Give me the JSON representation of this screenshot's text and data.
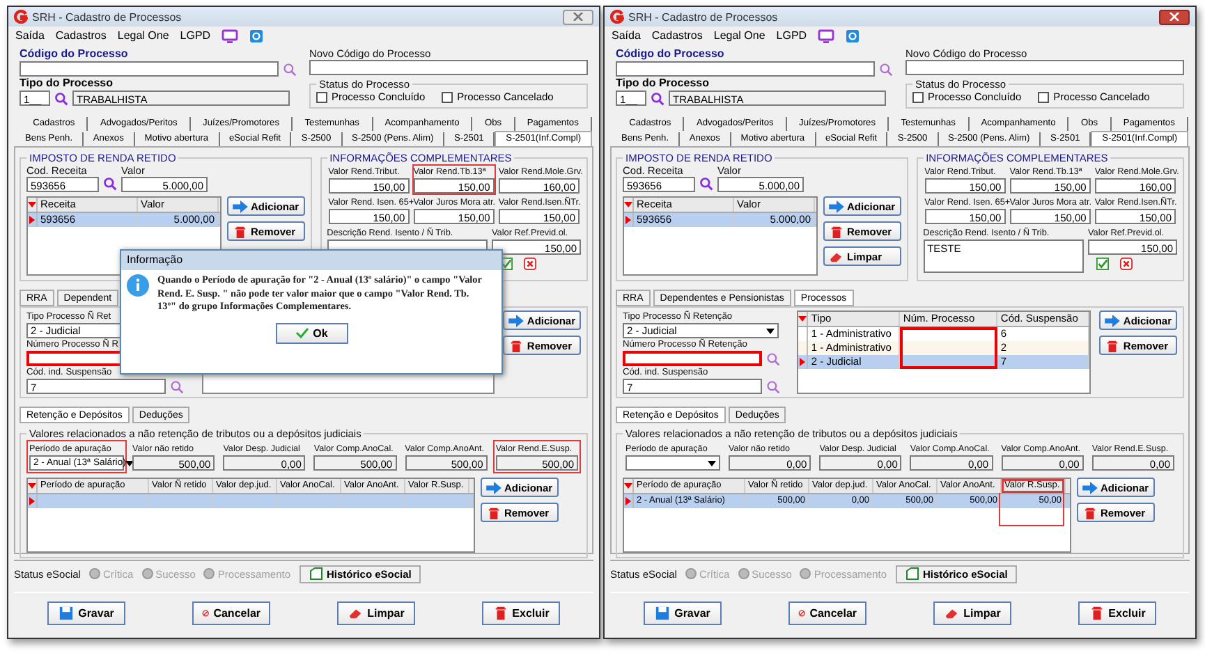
{
  "windows": [
    {
      "title": "SRH - Cadastro de Processos",
      "active": false,
      "menu": [
        "Saída",
        "Cadastros",
        "Legal One",
        "LGPD"
      ],
      "codigo": {
        "label": "Código do Processo"
      },
      "novo": {
        "label": "Novo Código do Processo"
      },
      "tipo": {
        "label": "Tipo do Processo",
        "code": "1__",
        "name": "TRABALHISTA"
      },
      "status_group": {
        "title": "Status do Processo",
        "options": [
          {
            "label": "Processo Concluído",
            "checked": false
          },
          {
            "label": "Processo Cancelado",
            "checked": false
          }
        ]
      },
      "tabs": [
        [
          {
            "label": "Cadastros",
            "selected": false
          },
          {
            "label": "Advogados/Peritos",
            "selected": false
          },
          {
            "label": "Juízes/Promotores",
            "selected": false
          },
          {
            "label": "Testemunhas",
            "selected": false
          },
          {
            "label": "Acompanhamento",
            "selected": false
          },
          {
            "label": "Obs",
            "selected": false
          },
          {
            "label": "Pagamentos",
            "selected": false
          }
        ],
        [
          {
            "label": "Bens Penh.",
            "selected": false
          },
          {
            "label": "Anexos",
            "selected": false
          },
          {
            "label": "Motivo abertura",
            "selected": false
          },
          {
            "label": "eSocial Refit",
            "selected": false
          },
          {
            "label": "S-2500",
            "selected": false
          },
          {
            "label": "S-2500 (Pens. Alim)",
            "selected": false
          },
          {
            "label": "S-2501",
            "selected": false
          },
          {
            "label": "S-2501(Inf.Compl)",
            "selected": true
          }
        ]
      ],
      "imposto": {
        "title": "IMPOSTO DE RENDA RETIDO",
        "cod_label": "Cod. Receita",
        "cod_value": "593656",
        "valor_label": "Valor",
        "valor_value": "5.000,00",
        "columns": [
          "Receita",
          "Valor"
        ],
        "rows": [
          {
            "cells": [
              "593656",
              "5.000,00"
            ],
            "selected": true
          }
        ],
        "buttons": [
          {
            "kind": "add",
            "label": "Adicionar"
          },
          {
            "kind": "remove",
            "label": "Remover"
          }
        ]
      },
      "info": {
        "title": "INFORMAÇÕES COMPLEMENTARES",
        "fields": [
          {
            "label": "Valor Rend.Tribut.",
            "value": "150,00",
            "highlighted": false
          },
          {
            "label": "Valor Rend.Tb.13ª",
            "value": "150,00",
            "highlighted": true
          },
          {
            "label": "Valor Rend.Mole.Grv.",
            "value": "160,00",
            "highlighted": false
          },
          {
            "label": "Valor Rend. Isen. 65+",
            "value": "150,00",
            "highlighted": false
          },
          {
            "label": "Valor Juros Mora atr.",
            "value": "150,00",
            "highlighted": false
          },
          {
            "label": "Valor Rend.Isen.ÑTr.",
            "value": "150,00",
            "highlighted": false
          }
        ],
        "descricao": {
          "label": "Descrição Rend. Isento / Ñ Trib."
        },
        "previd": {
          "label": "Valor Ref.Previd.ol.",
          "value": "150,00"
        }
      },
      "subtabs": [
        {
          "label": "RRA",
          "selected": false
        },
        {
          "label": "Dependent",
          "selected": false
        }
      ],
      "processos": {
        "tipo": {
          "label": "Tipo Processo Ñ Ret",
          "value": "2 - Judicial"
        },
        "numero": {
          "label": "Número Processo Ñ R",
          "highlighted": true
        },
        "cod": {
          "label": "Cód. ind. Suspensão",
          "value": "7"
        },
        "buttons": [
          {
            "kind": "add",
            "label": "Adicionar"
          },
          {
            "kind": "remove",
            "label": "Remover"
          }
        ]
      },
      "inner_tabs": [
        {
          "label": "Retenção e Depósitos",
          "selected": true
        },
        {
          "label": "Deduções",
          "selected": false
        }
      ],
      "valores": {
        "title": "Valores relacionados a não retenção de tributos ou a depósitos judiciais",
        "periodo": {
          "label": "Período de apuração",
          "value": "2 - Anual (13ª Salário)",
          "highlighted": true
        },
        "fields": [
          {
            "label": "Valor não retido",
            "value": "500,00",
            "highlighted": false
          },
          {
            "label": "Valor Desp. Judicial",
            "value": "0,00",
            "highlighted": false
          },
          {
            "label": "Valor Comp.AnoCal.",
            "value": "500,00",
            "highlighted": false
          },
          {
            "label": "Valor Comp.AnoAnt.",
            "value": "500,00",
            "highlighted": false
          },
          {
            "label": "Valor Rend.E.Susp.",
            "value": "500,00",
            "highlighted": true
          }
        ],
        "columns": [
          {
            "label": "Período de apuração",
            "highlighted": false
          },
          {
            "label": "Valor Ñ retido",
            "highlighted": false
          },
          {
            "label": "Valor dep.jud.",
            "highlighted": false
          },
          {
            "label": "Valor AnoCal.",
            "highlighted": false
          },
          {
            "label": "Valor AnoAnt.",
            "highlighted": false
          },
          {
            "label": "Valor R.Susp.",
            "highlighted": false
          }
        ],
        "rows": [
          {
            "selected": true
          }
        ],
        "buttons": [
          {
            "kind": "add",
            "label": "Adicionar"
          },
          {
            "kind": "remove",
            "label": "Remover"
          }
        ]
      },
      "status": {
        "label": "Status eSocial",
        "radios": [
          {
            "label": "Crítica",
            "disabled": true
          },
          {
            "label": "Sucesso",
            "disabled": true
          },
          {
            "label": "Processamento",
            "disabled": true
          }
        ],
        "history": "Histórico eSocial"
      },
      "footer": [
        {
          "kind": "save",
          "label": "Gravar"
        },
        {
          "kind": "cancel",
          "label": "Cancelar"
        },
        {
          "kind": "clear",
          "label": "Limpar"
        },
        {
          "kind": "delete",
          "label": "Excluir"
        }
      ],
      "dialog": {
        "title": "Informação",
        "message": "Quando o Período de apuração for \"2 - Anual (13º salário)\" o campo \"Valor Rend. E. Susp. \" não pode ter valor maior que o campo \"Valor Rend. Tb. 13º\" do grupo Informações Complementares.",
        "button": "Ok"
      }
    },
    {
      "title": "SRH - Cadastro de Processos",
      "active": true,
      "menu": [
        "Saída",
        "Cadastros",
        "Legal One",
        "LGPD"
      ],
      "codigo": {
        "label": "Código do Processo"
      },
      "novo": {
        "label": "Novo Código do Processo"
      },
      "tipo": {
        "label": "Tipo do Processo",
        "code": "1__",
        "name": "TRABALHISTA"
      },
      "status_group": {
        "title": "Status do Processo",
        "options": [
          {
            "label": "Processo Concluído",
            "checked": false
          },
          {
            "label": "Processo Cancelado",
            "checked": false
          }
        ]
      },
      "tabs": [
        [
          {
            "label": "Cadastros",
            "selected": false
          },
          {
            "label": "Advogados/Peritos",
            "selected": false
          },
          {
            "label": "Juízes/Promotores",
            "selected": false
          },
          {
            "label": "Testemunhas",
            "selected": false
          },
          {
            "label": "Acompanhamento",
            "selected": false
          },
          {
            "label": "Obs",
            "selected": false
          },
          {
            "label": "Pagamentos",
            "selected": false
          }
        ],
        [
          {
            "label": "Bens Penh.",
            "selected": false
          },
          {
            "label": "Anexos",
            "selected": false
          },
          {
            "label": "Motivo abertura",
            "selected": false
          },
          {
            "label": "eSocial Refit",
            "selected": false
          },
          {
            "label": "S-2500",
            "selected": false
          },
          {
            "label": "S-2500 (Pens. Alim)",
            "selected": false
          },
          {
            "label": "S-2501",
            "selected": false
          },
          {
            "label": "S-2501(Inf.Compl)",
            "selected": true
          }
        ]
      ],
      "imposto": {
        "title": "IMPOSTO DE RENDA RETIDO",
        "cod_label": "Cod. Receita",
        "cod_value": "593656",
        "valor_label": "Valor",
        "valor_value": "5.000,00",
        "columns": [
          "Receita",
          "Valor"
        ],
        "rows": [
          {
            "cells": [
              "593656",
              "5.000,00"
            ],
            "selected": true
          }
        ],
        "buttons": [
          {
            "kind": "add",
            "label": "Adicionar"
          },
          {
            "kind": "remove",
            "label": "Remover"
          },
          {
            "kind": "clear",
            "label": "Limpar"
          }
        ]
      },
      "info": {
        "title": "INFORMAÇÕES COMPLEMENTARES",
        "fields": [
          {
            "label": "Valor Rend.Tribut.",
            "value": "150,00",
            "highlighted": false
          },
          {
            "label": "Valor Rend.Tb.13ª",
            "value": "150,00",
            "highlighted": false
          },
          {
            "label": "Valor Rend.Mole.Grv.",
            "value": "160,00",
            "highlighted": false
          },
          {
            "label": "Valor Rend. Isen. 65+",
            "value": "150,00",
            "highlighted": false
          },
          {
            "label": "Valor Juros Mora atr.",
            "value": "150,00",
            "highlighted": false
          },
          {
            "label": "Valor Rend.Isen.ÑTr.",
            "value": "150,00",
            "highlighted": false
          }
        ],
        "descricao": {
          "label": "Descrição Rend. Isento / Ñ Trib.",
          "value": "TESTE"
        },
        "previd": {
          "label": "Valor Ref.Previd.ol.",
          "value": "150,00"
        }
      },
      "subtabs": [
        {
          "label": "RRA",
          "selected": false
        },
        {
          "label": "Dependentes e Pensionistas",
          "selected": false
        },
        {
          "label": "Processos",
          "selected": true
        }
      ],
      "processos": {
        "tipo": {
          "label": "Tipo Processo Ñ Retenção",
          "value": "2 - Judicial"
        },
        "numero": {
          "label": "Número Processo Ñ Retenção",
          "highlighted": true
        },
        "cod": {
          "label": "Cód. ind. Suspensão",
          "value": "7"
        },
        "columns": [
          "Tipo",
          "Núm. Processo",
          "Cód. Suspensão"
        ],
        "num_highlighted": true,
        "rows": [
          {
            "tipo": "1 - Administrativo",
            "cod": "6",
            "selected": false
          },
          {
            "tipo": "1 - Administrativo",
            "cod": "2",
            "selected": false
          },
          {
            "tipo": "2 - Judicial",
            "cod": "7",
            "selected": true
          }
        ],
        "buttons": [
          {
            "kind": "add",
            "label": "Adicionar"
          },
          {
            "kind": "remove",
            "label": "Remover"
          }
        ]
      },
      "inner_tabs": [
        {
          "label": "Retenção e Depósitos",
          "selected": true
        },
        {
          "label": "Deduções",
          "selected": false
        }
      ],
      "valores": {
        "title": "Valores relacionados a não retenção de tributos ou a depósitos judiciais",
        "periodo": {
          "label": "Período de apuração",
          "highlighted": false
        },
        "fields": [
          {
            "label": "Valor não retido",
            "value": "0,00",
            "highlighted": false
          },
          {
            "label": "Valor Desp. Judicial",
            "value": "0,00",
            "highlighted": false
          },
          {
            "label": "Valor Comp.AnoCal.",
            "value": "0,00",
            "highlighted": false
          },
          {
            "label": "Valor Comp.AnoAnt.",
            "value": "0,00",
            "highlighted": false
          },
          {
            "label": "Valor Rend.E.Susp.",
            "value": "0,00",
            "highlighted": false
          }
        ],
        "columns": [
          {
            "label": "Período de apuração",
            "highlighted": false
          },
          {
            "label": "Valor Ñ retido",
            "highlighted": false
          },
          {
            "label": "Valor dep.jud.",
            "highlighted": false
          },
          {
            "label": "Valor AnoCal.",
            "highlighted": false
          },
          {
            "label": "Valor AnoAnt.",
            "highlighted": false
          },
          {
            "label": "Valor R.Susp.",
            "highlighted": true
          }
        ],
        "rows": [
          {
            "cells": [
              "2 - Anual (13ª Salário)",
              "500,00",
              "0,00",
              "500,00",
              "500,00",
              "50,00"
            ],
            "selected": true
          }
        ],
        "buttons": [
          {
            "kind": "add",
            "label": "Adicionar"
          },
          {
            "kind": "remove",
            "label": "Remover"
          }
        ]
      },
      "status": {
        "label": "Status eSocial",
        "radios": [
          {
            "label": "Crítica",
            "disabled": true
          },
          {
            "label": "Sucesso",
            "disabled": true
          },
          {
            "label": "Processamento",
            "disabled": true
          }
        ],
        "history": "Histórico eSocial"
      },
      "footer": [
        {
          "kind": "save",
          "label": "Gravar"
        },
        {
          "kind": "cancel",
          "label": "Cancelar"
        },
        {
          "kind": "clear",
          "label": "Limpar"
        },
        {
          "kind": "delete",
          "label": "Excluir"
        }
      ]
    }
  ]
}
